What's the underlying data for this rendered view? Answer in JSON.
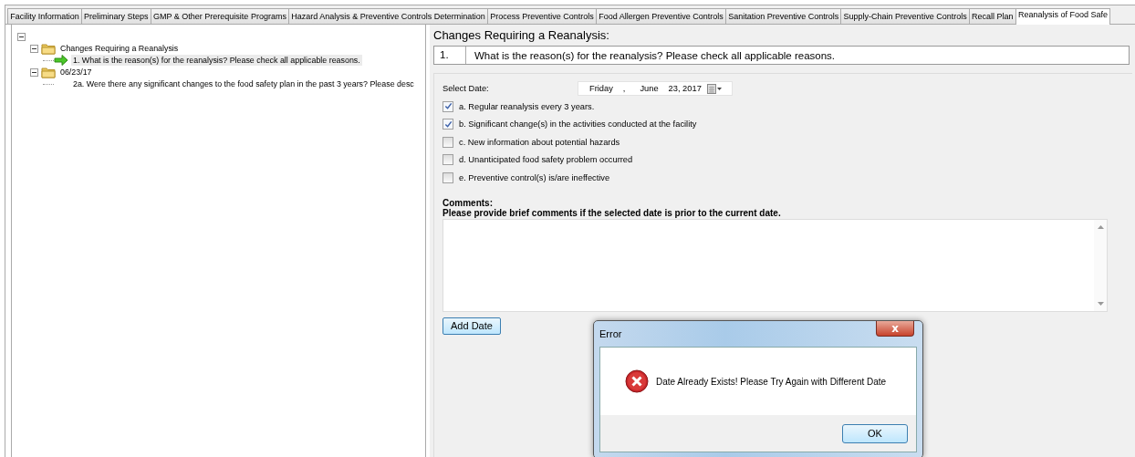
{
  "tabs": [
    {
      "label": "Facility Information",
      "selected": false
    },
    {
      "label": "Preliminary Steps",
      "selected": false
    },
    {
      "label": "GMP & Other Prerequisite Programs",
      "selected": false
    },
    {
      "label": "Hazard Analysis & Preventive Controls Determination",
      "selected": false
    },
    {
      "label": "Process Preventive Controls",
      "selected": false
    },
    {
      "label": "Food Allergen Preventive Controls",
      "selected": false
    },
    {
      "label": "Sanitation Preventive Controls",
      "selected": false
    },
    {
      "label": "Supply-Chain Preventive Controls",
      "selected": false
    },
    {
      "label": "Recall Plan",
      "selected": false
    },
    {
      "label": "Reanalysis of Food Safe",
      "selected": true
    }
  ],
  "tree": {
    "expanded": true,
    "children": [
      {
        "label": "Changes Requiring a Reanalysis",
        "kind": "folder",
        "expanded": true,
        "children": [
          {
            "label": "1.  What is the reason(s) for the reanalysis? Please check all applicable reasons.",
            "kind": "question",
            "selected": true
          }
        ]
      },
      {
        "label": "06/23/17",
        "kind": "folder",
        "expanded": true,
        "children": [
          {
            "label": "2a. Were there any significant changes to the food safety plan in the past 3 years? Please desc",
            "kind": "question",
            "selected": false
          }
        ]
      }
    ]
  },
  "section_title": "Changes Requiring a Reanalysis:",
  "question": {
    "number": "1.",
    "text": "What is the reason(s) for the reanalysis? Please check all applicable reasons."
  },
  "date_label": "Select Date:",
  "date_parts": [
    "Friday",
    ",",
    "June",
    "23, 2017"
  ],
  "reasons": [
    {
      "label": "a. Regular reanalysis every 3 years.",
      "checked": true
    },
    {
      "label": "b. Significant change(s) in the activities conducted at the facility",
      "checked": true
    },
    {
      "label": "c. New information about potential hazards",
      "checked": false
    },
    {
      "label": "d. Unanticipated food safety problem occurred",
      "checked": false
    },
    {
      "label": "e. Preventive control(s) is/are ineffective",
      "checked": false
    }
  ],
  "comments_label": "Comments:",
  "comments_hint": "Please provide brief comments if the selected date is prior to the current date.",
  "add_button": "Add Date",
  "dialog": {
    "title": "Error",
    "close": "x",
    "message": "Date Already Exists! Please Try Again with Different Date",
    "button": "OK"
  }
}
